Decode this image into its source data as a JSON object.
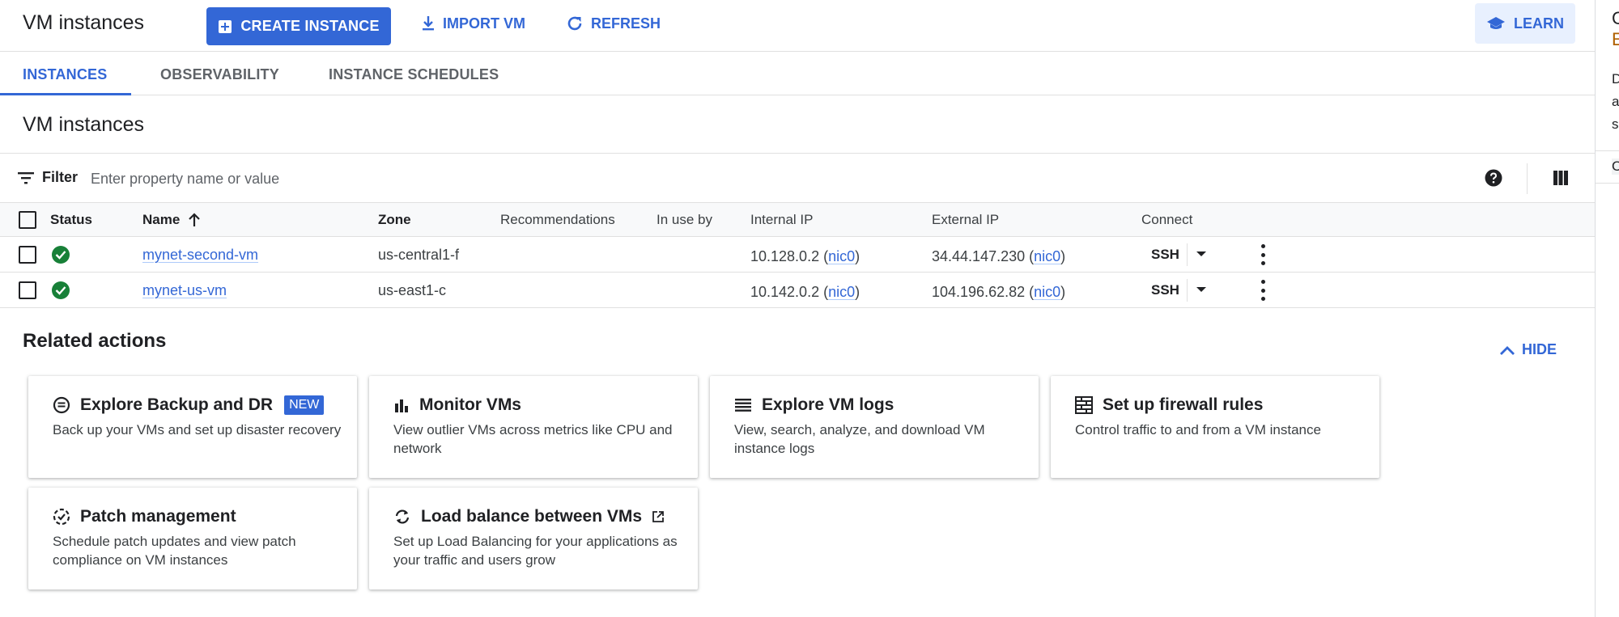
{
  "toolbar": {
    "title": "VM instances",
    "create_label": "CREATE INSTANCE",
    "import_label": "IMPORT VM",
    "refresh_label": "REFRESH",
    "learn_label": "LEARN"
  },
  "tabs": [
    {
      "label": "INSTANCES",
      "active": true
    },
    {
      "label": "OBSERVABILITY",
      "active": false
    },
    {
      "label": "INSTANCE SCHEDULES",
      "active": false
    }
  ],
  "section_title": "VM instances",
  "filter": {
    "label": "Filter",
    "placeholder": "Enter property name or value"
  },
  "table": {
    "columns": [
      "Status",
      "Name",
      "Zone",
      "Recommendations",
      "In use by",
      "Internal IP",
      "External IP",
      "Connect"
    ],
    "sort_column": "Name",
    "rows": [
      {
        "name": "mynet-second-vm",
        "zone": "us-central1-f",
        "internal_ip": "10.128.0.2",
        "internal_nic": "nic0",
        "external_ip": "34.44.147.230",
        "external_nic": "nic0",
        "connect": "SSH",
        "status": "running"
      },
      {
        "name": "mynet-us-vm",
        "zone": "us-east1-c",
        "internal_ip": "10.142.0.2",
        "internal_nic": "nic0",
        "external_ip": "104.196.62.82",
        "external_nic": "nic0",
        "connect": "SSH",
        "status": "running"
      }
    ]
  },
  "related": {
    "title": "Related actions",
    "hide_label": "HIDE",
    "cards": [
      {
        "title": "Explore Backup and DR",
        "badge": "NEW",
        "desc": "Back up your VMs and set up disaster recovery",
        "icon": "backup-icon"
      },
      {
        "title": "Monitor VMs",
        "desc": "View outlier VMs across metrics like CPU and network",
        "icon": "bar-chart-icon"
      },
      {
        "title": "Explore VM logs",
        "desc": "View, search, analyze, and download VM instance logs",
        "icon": "logs-icon"
      },
      {
        "title": "Set up firewall rules",
        "desc": "Control traffic to and from a VM instance",
        "icon": "firewall-icon"
      },
      {
        "title": "Patch management",
        "desc": "Schedule patch updates and view patch compliance on VM instances",
        "icon": "patch-icon"
      },
      {
        "title": "Load balance between VMs",
        "desc": "Set up Load Balancing for your applications as your traffic and users grow",
        "icon": "sync-icon"
      }
    ]
  },
  "side_panel": {
    "fragments": [
      "C",
      "E",
      "D",
      "a",
      "s",
      "C"
    ]
  },
  "colors": {
    "accent": "#3367d6",
    "status_ok": "#188038",
    "learn_bg": "#e8f0fe"
  }
}
